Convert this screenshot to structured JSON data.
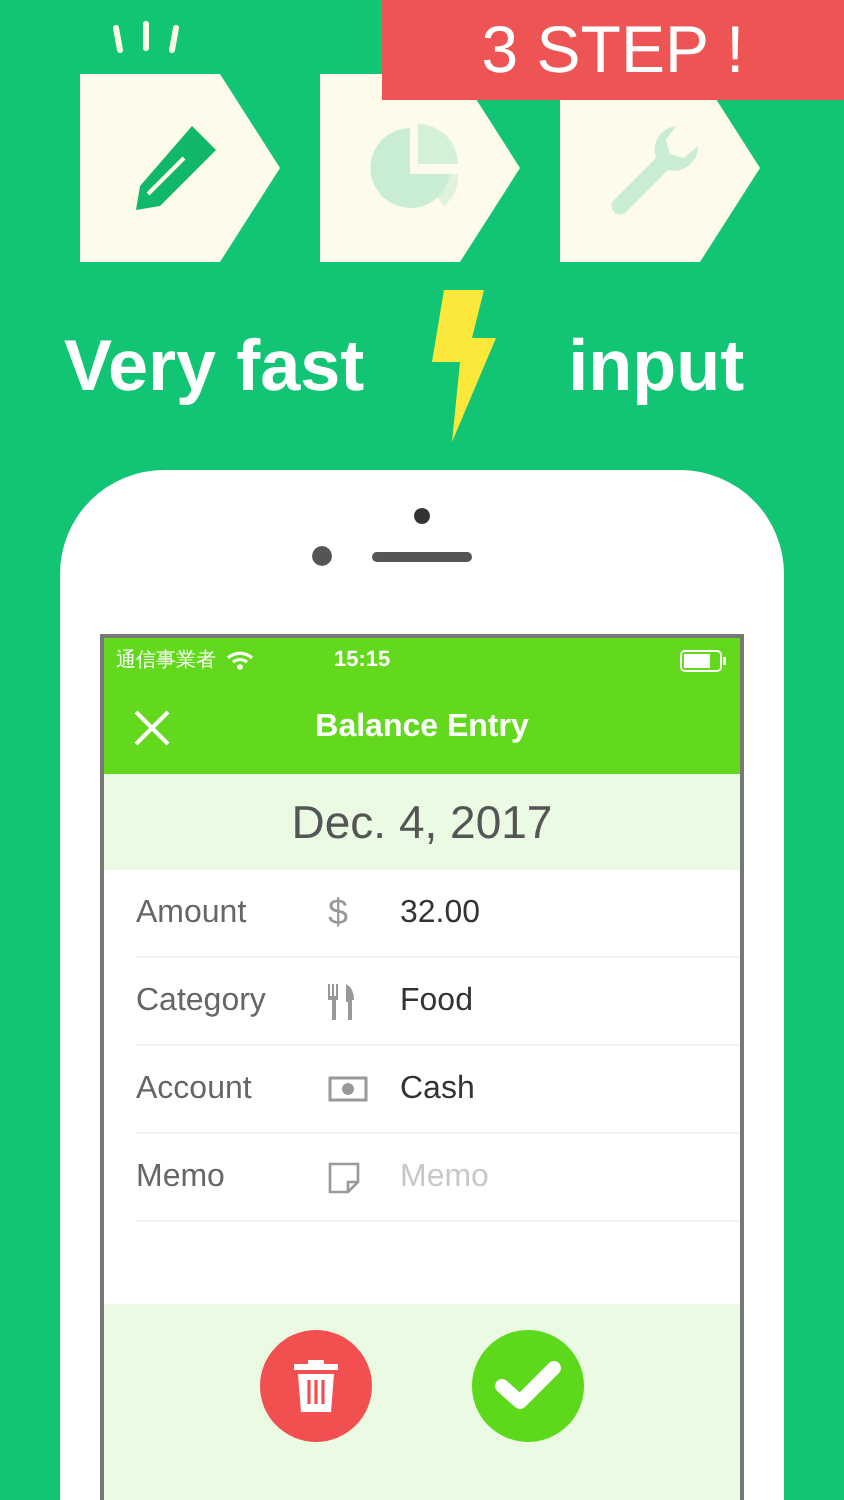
{
  "banner": "3 STEP !",
  "steps": [
    {
      "kind": "pencil",
      "selected": true
    },
    {
      "kind": "pie",
      "selected": false
    },
    {
      "kind": "wrench",
      "selected": false
    }
  ],
  "headline": [
    "Very fast",
    "input"
  ],
  "phone": {
    "status_bar": {
      "carrier": "通信事業者",
      "time": "15:15"
    },
    "nav_bar": {
      "title": "Balance Entry"
    },
    "date": "Dec. 4, 2017",
    "fields": [
      {
        "kind": "amount",
        "label": "Amount",
        "icon": "$",
        "value": "32.00"
      },
      {
        "kind": "category",
        "label": "Category",
        "value": "Food"
      },
      {
        "kind": "account",
        "label": "Account",
        "value": "Cash"
      },
      {
        "kind": "memo",
        "label": "Memo",
        "placeholder": "Memo"
      }
    ]
  }
}
